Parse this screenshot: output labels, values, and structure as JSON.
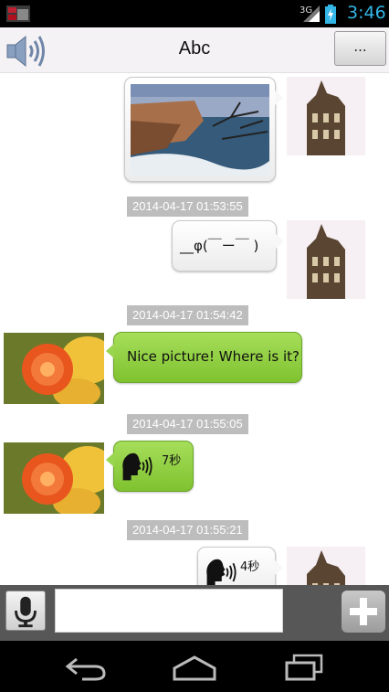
{
  "status_bar": {
    "network": "3G",
    "time": "3:46",
    "icons": [
      "notification-icon",
      "signal-icon",
      "battery-charging-icon"
    ]
  },
  "header": {
    "title": "Abc",
    "more_label": "...",
    "speaker_icon": "speaker-icon"
  },
  "messages": [
    {
      "kind": "image",
      "side": "right",
      "avatar": "building-photo"
    },
    {
      "kind": "timestamp",
      "text": "2014-04-17 01:53:55"
    },
    {
      "kind": "text",
      "side": "right",
      "text": "__φ(￣ー￣ )",
      "avatar": "building-photo"
    },
    {
      "kind": "timestamp",
      "text": "2014-04-17 01:54:42"
    },
    {
      "kind": "text",
      "side": "left",
      "text": "Nice picture! Where is it?",
      "avatar": "flower-photo"
    },
    {
      "kind": "timestamp",
      "text": "2014-04-17 01:55:05"
    },
    {
      "kind": "voice",
      "side": "left",
      "duration": "7秒",
      "avatar": "flower-photo"
    },
    {
      "kind": "timestamp",
      "text": "2014-04-17 01:55:21"
    },
    {
      "kind": "voice",
      "side": "right",
      "duration": "4秒",
      "avatar": "building-photo"
    }
  ],
  "input_bar": {
    "value": "",
    "placeholder": "",
    "mic_icon": "microphone-icon",
    "plus_icon": "plus-icon"
  },
  "nav_bar": {
    "icons": [
      "back-icon",
      "home-icon",
      "recent-apps-icon"
    ]
  },
  "colors": {
    "accent": "#33b5e5",
    "bubble_green": "#8fcf42",
    "timestamp_bg": "#bdbdbd",
    "input_bar_bg": "#575757"
  }
}
